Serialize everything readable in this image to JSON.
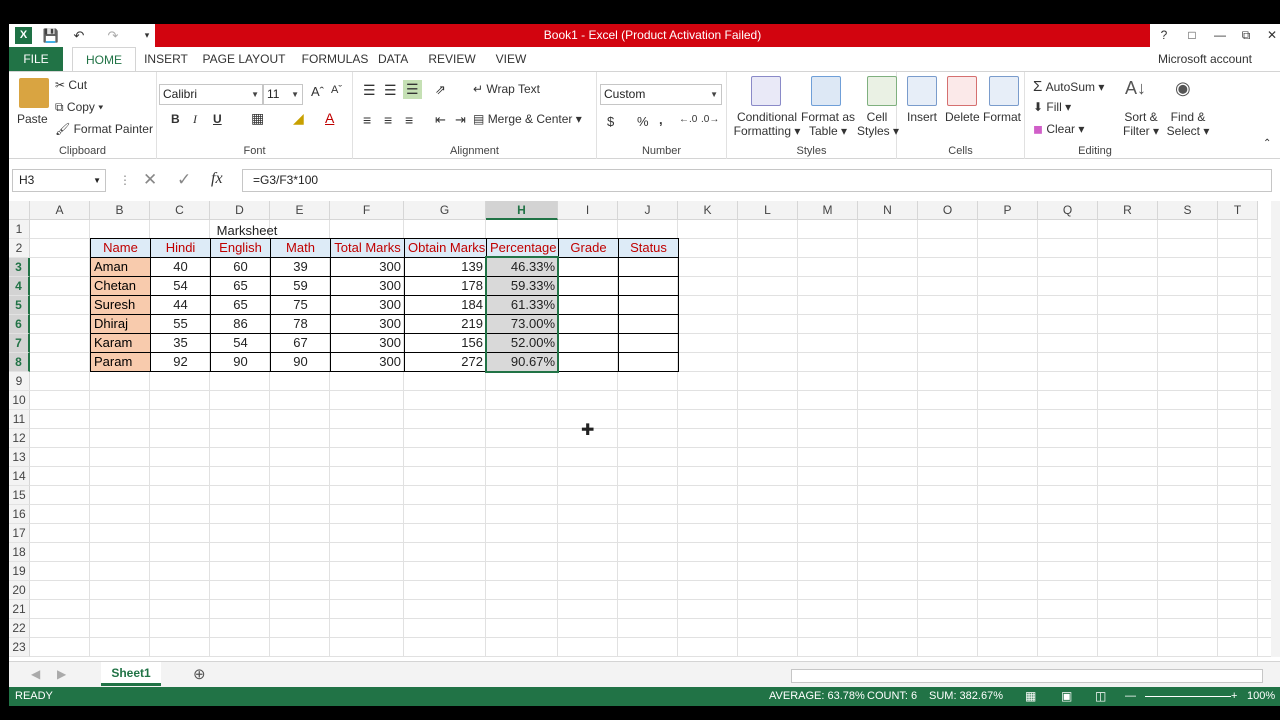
{
  "titlebar": {
    "title": "Book1 -  Excel (Product Activation Failed)",
    "help": "?"
  },
  "tabs": [
    "FILE",
    "HOME",
    "INSERT",
    "PAGE LAYOUT",
    "FORMULAS",
    "DATA",
    "REVIEW",
    "VIEW"
  ],
  "account": "Microsoft account",
  "ribbon": {
    "clipboard": {
      "paste": "Paste",
      "cut": "Cut",
      "copy": "Copy",
      "format_painter": "Format Painter",
      "label": "Clipboard"
    },
    "font": {
      "name": "Calibri",
      "size": "11",
      "bold": "B",
      "italic": "I",
      "underline": "U",
      "label": "Font"
    },
    "alignment": {
      "wrap_text": "Wrap Text",
      "merge_center": "Merge & Center",
      "label": "Alignment"
    },
    "number": {
      "format": "Custom",
      "currency": "$",
      "percent": "%",
      "comma": ",",
      "label": "Number"
    },
    "styles": {
      "conditional": "Conditional",
      "conditional2": "Formatting",
      "format_as": "Format as",
      "format_as2": "Table",
      "cell": "Cell",
      "cell2": "Styles",
      "label": "Styles"
    },
    "cells": {
      "insert": "Insert",
      "delete": "Delete",
      "format": "Format",
      "label": "Cells"
    },
    "editing": {
      "autosum": "AutoSum",
      "fill": "Fill",
      "clear": "Clear",
      "sort": "Sort &",
      "sort2": "Filter",
      "find": "Find &",
      "find2": "Select",
      "label": "Editing"
    }
  },
  "formula_bar": {
    "name_box": "H3",
    "fx": "fx",
    "formula": "=G3/F3*100"
  },
  "columns": [
    "A",
    "B",
    "C",
    "D",
    "E",
    "F",
    "G",
    "H",
    "I",
    "J",
    "K",
    "L",
    "M",
    "N",
    "O",
    "P",
    "Q",
    "R",
    "S",
    "T"
  ],
  "rows": [
    "1",
    "2",
    "3",
    "4",
    "5",
    "6",
    "7",
    "8",
    "9",
    "10",
    "11",
    "12",
    "13",
    "14",
    "15",
    "16",
    "17",
    "18",
    "19",
    "20",
    "21",
    "22",
    "23"
  ],
  "sheet": {
    "title": "Marksheet",
    "headers": [
      "Name",
      "Hindi",
      "English",
      "Math",
      "Total Marks",
      "Obtain Marks",
      "Percentage",
      "Grade",
      "Status"
    ],
    "data": [
      [
        "Aman",
        "40",
        "60",
        "39",
        "300",
        "139",
        "46.33%"
      ],
      [
        "Chetan",
        "54",
        "65",
        "59",
        "300",
        "178",
        "59.33%"
      ],
      [
        "Suresh",
        "44",
        "65",
        "75",
        "300",
        "184",
        "61.33%"
      ],
      [
        "Dhiraj",
        "55",
        "86",
        "78",
        "300",
        "219",
        "73.00%"
      ],
      [
        "Karam",
        "35",
        "54",
        "67",
        "300",
        "156",
        "52.00%"
      ],
      [
        "Param",
        "92",
        "90",
        "90",
        "300",
        "272",
        "90.67%"
      ]
    ]
  },
  "sheet_tab": "Sheet1",
  "status": {
    "ready": "READY",
    "average": "AVERAGE: 63.78%",
    "count": "COUNT: 6",
    "sum": "SUM: 382.67%",
    "zoom": "100%"
  }
}
